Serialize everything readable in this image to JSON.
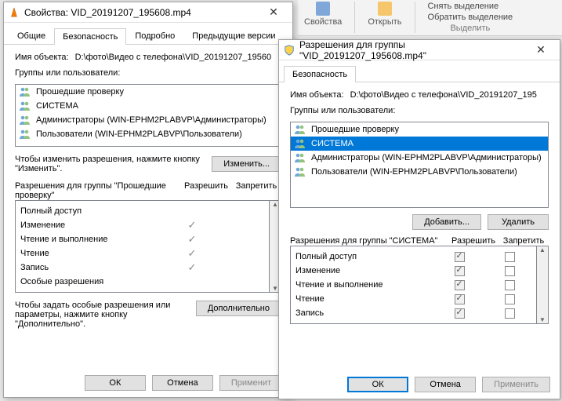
{
  "ribbon": {
    "props": "Свойства",
    "open": "Открыть",
    "deselect": "Снять выделение",
    "invert": "Обратить выделение",
    "select": "Выделить"
  },
  "dlg1": {
    "title": "Свойства: VID_20191207_195608.mp4",
    "tabs": {
      "general": "Общие",
      "security": "Безопасность",
      "details": "Подробно",
      "prev": "Предыдущие версии"
    },
    "objlabel": "Имя объекта:",
    "objvalue": "D:\\фото\\Видео с телефона\\VID_20191207_19560",
    "groupslabel": "Группы или пользователи:",
    "principals": [
      "Прошедшие проверку",
      "СИСТЕМА",
      "Администраторы (WIN-EPHM2PLABVP\\Администраторы)",
      "Пользователи (WIN-EPHM2PLABVP\\Пользователи)"
    ],
    "changetext": "Чтобы изменить разрешения, нажмите кнопку \"Изменить\".",
    "changebtn": "Изменить...",
    "permfor": "Разрешения для группы \"Прошедшие проверку\"",
    "allow": "Разрешить",
    "deny": "Запретить",
    "perms": [
      {
        "name": "Полный доступ",
        "allow": false
      },
      {
        "name": "Изменение",
        "allow": true
      },
      {
        "name": "Чтение и выполнение",
        "allow": true
      },
      {
        "name": "Чтение",
        "allow": true
      },
      {
        "name": "Запись",
        "allow": true
      },
      {
        "name": "Особые разрешения",
        "allow": false
      }
    ],
    "advtext": "Чтобы задать особые разрешения или параметры, нажмите кнопку \"Дополнительно\".",
    "advbtn": "Дополнительно",
    "ok": "ОК",
    "cancel": "Отмена",
    "apply": "Применит"
  },
  "dlg2": {
    "title": "Разрешения для группы \"VID_20191207_195608.mp4\"",
    "tab": "Безопасность",
    "objlabel": "Имя объекта:",
    "objvalue": "D:\\фото\\Видео с телефона\\VID_20191207_195",
    "groupslabel": "Группы или пользователи:",
    "principals": [
      "Прошедшие проверку",
      "СИСТЕМА",
      "Администраторы (WIN-EPHM2PLABVP\\Администраторы)",
      "Пользователи (WIN-EPHM2PLABVP\\Пользователи)"
    ],
    "selected": 1,
    "add": "Добавить...",
    "remove": "Удалить",
    "permfor": "Разрешения для группы \"СИСТЕМА\"",
    "allow": "Разрешить",
    "deny": "Запретить",
    "perms": [
      {
        "name": "Полный доступ",
        "allow": true,
        "deny": false
      },
      {
        "name": "Изменение",
        "allow": true,
        "deny": false
      },
      {
        "name": "Чтение и выполнение",
        "allow": true,
        "deny": false
      },
      {
        "name": "Чтение",
        "allow": true,
        "deny": false
      },
      {
        "name": "Запись",
        "allow": true,
        "deny": false
      }
    ],
    "ok": "ОК",
    "cancel": "Отмена",
    "apply": "Применить"
  }
}
